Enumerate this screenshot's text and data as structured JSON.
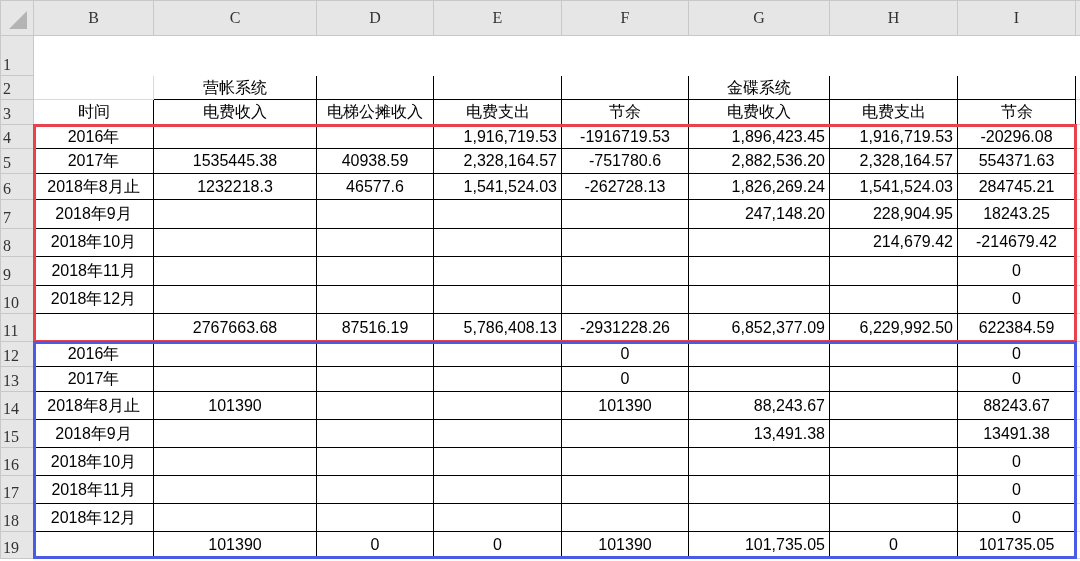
{
  "columns": [
    "B",
    "C",
    "D",
    "E",
    "F",
    "G",
    "H",
    "I"
  ],
  "header_rows": [
    {
      "row": "1"
    },
    {
      "row": "2",
      "C": "营帐系统",
      "G": "金碟系统"
    },
    {
      "row": "3",
      "B": "时间",
      "C": "电费收入",
      "D": "电梯公摊收入",
      "E": "电费支出",
      "F": "节余",
      "G": "电费收入",
      "H": "电费支出",
      "I": "节余"
    }
  ],
  "blocks": [
    {
      "color": "#e8424c",
      "rows": [
        {
          "row": "4",
          "B": "2016年",
          "E": "1,916,719.53",
          "F": "-1916719.53",
          "G": "1,896,423.45",
          "H": "1,916,719.53",
          "I": "-20296.08"
        },
        {
          "row": "5",
          "B": "2017年",
          "C": "1535445.38",
          "D": "40938.59",
          "E": "2,328,164.57",
          "F": "-751780.6",
          "G": "2,882,536.20",
          "H": "2,328,164.57",
          "I": "554371.63"
        },
        {
          "row": "6",
          "B": "2018年8月止",
          "C": "1232218.3",
          "D": "46577.6",
          "E": "1,541,524.03",
          "F": "-262728.13",
          "G": "1,826,269.24",
          "H": "1,541,524.03",
          "I": "284745.21"
        },
        {
          "row": "7",
          "B": "2018年9月",
          "G": "247,148.20",
          "H": "228,904.95",
          "I": "18243.25"
        },
        {
          "row": "8",
          "B": "2018年10月",
          "H": "214,679.42",
          "I": "-214679.42"
        },
        {
          "row": "9",
          "B": "2018年11月",
          "I": "0"
        },
        {
          "row": "10",
          "B": "2018年12月",
          "I": "0"
        },
        {
          "row": "11",
          "C": "2767663.68",
          "D": "87516.19",
          "E": "5,786,408.13",
          "F": "-2931228.26",
          "G": "6,852,377.09",
          "H": "6,229,992.50",
          "I": "622384.59"
        }
      ]
    },
    {
      "color": "#4a5be6",
      "rows": [
        {
          "row": "12",
          "B": "2016年",
          "F": "0",
          "I": "0"
        },
        {
          "row": "13",
          "B": "2017年",
          "F": "0",
          "I": "0"
        },
        {
          "row": "14",
          "B": "2018年8月止",
          "C": "101390",
          "F": "101390",
          "G": "88,243.67",
          "I": "88243.67"
        },
        {
          "row": "15",
          "B": "2018年9月",
          "G": "13,491.38",
          "I": "13491.38"
        },
        {
          "row": "16",
          "B": "2018年10月",
          "I": "0"
        },
        {
          "row": "17",
          "B": "2018年11月",
          "I": "0"
        },
        {
          "row": "18",
          "B": "2018年12月",
          "I": "0"
        },
        {
          "row": "19",
          "C": "101390",
          "D": "0",
          "E": "0",
          "F": "101390",
          "G": "101,735.05",
          "H": "0",
          "I": "101735.05"
        }
      ]
    }
  ]
}
